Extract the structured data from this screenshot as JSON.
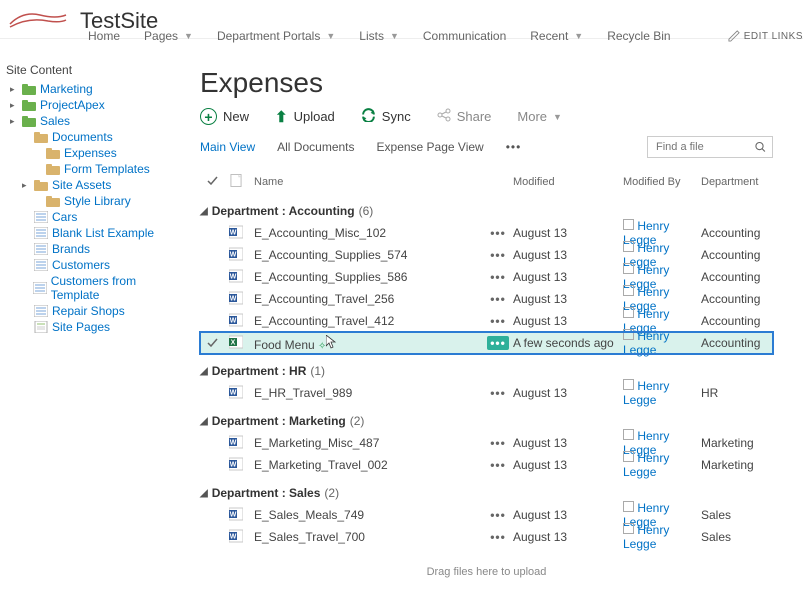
{
  "header": {
    "site_title": "TestSite",
    "nav": [
      "Home",
      "Pages",
      "Department Portals",
      "Lists",
      "Communication",
      "Recent",
      "Recycle Bin"
    ],
    "nav_has_dropdown": [
      false,
      true,
      true,
      true,
      false,
      true,
      false
    ],
    "edit_links_label": "EDIT LINKS"
  },
  "sidebar": {
    "heading": "Site Content",
    "items": [
      {
        "label": "Marketing",
        "level": 1,
        "icon": "folder-green",
        "expandable": true
      },
      {
        "label": "ProjectApex",
        "level": 1,
        "icon": "folder-green",
        "expandable": true
      },
      {
        "label": "Sales",
        "level": 1,
        "icon": "folder-green",
        "expandable": true
      },
      {
        "label": "Documents",
        "level": 2,
        "icon": "folder-tan"
      },
      {
        "label": "Expenses",
        "level": 3,
        "icon": "folder-tan"
      },
      {
        "label": "Form Templates",
        "level": 3,
        "icon": "folder-tan"
      },
      {
        "label": "Site Assets",
        "level": 2,
        "icon": "folder-tan",
        "expandable": true
      },
      {
        "label": "Style Library",
        "level": 3,
        "icon": "folder-tan"
      },
      {
        "label": "Cars",
        "level": 2,
        "icon": "list"
      },
      {
        "label": "Blank List Example",
        "level": 2,
        "icon": "list"
      },
      {
        "label": "Brands",
        "level": 2,
        "icon": "list"
      },
      {
        "label": "Customers",
        "level": 2,
        "icon": "list"
      },
      {
        "label": "Customers from Template",
        "level": 2,
        "icon": "list"
      },
      {
        "label": "Repair Shops",
        "level": 2,
        "icon": "list"
      },
      {
        "label": "Site Pages",
        "level": 2,
        "icon": "page"
      }
    ]
  },
  "main": {
    "title": "Expenses",
    "toolbar": {
      "new": "New",
      "upload": "Upload",
      "sync": "Sync",
      "share": "Share",
      "more": "More"
    },
    "views": {
      "main_view": "Main View",
      "all_docs": "All Documents",
      "expense_page": "Expense Page View"
    },
    "search_placeholder": "Find a file",
    "columns": {
      "name": "Name",
      "modified": "Modified",
      "modified_by": "Modified By",
      "department": "Department"
    },
    "group_label": "Department",
    "groups": [
      {
        "name": "Accounting",
        "count": 6,
        "rows": [
          {
            "icon": "word",
            "name": "E_Accounting_Misc_102",
            "modified": "August 13",
            "by": "Henry Legge",
            "dept": "Accounting"
          },
          {
            "icon": "word",
            "name": "E_Accounting_Supplies_574",
            "modified": "August 13",
            "by": "Henry Legge",
            "dept": "Accounting"
          },
          {
            "icon": "word",
            "name": "E_Accounting_Supplies_586",
            "modified": "August 13",
            "by": "Henry Legge",
            "dept": "Accounting"
          },
          {
            "icon": "word",
            "name": "E_Accounting_Travel_256",
            "modified": "August 13",
            "by": "Henry Legge",
            "dept": "Accounting"
          },
          {
            "icon": "word",
            "name": "E_Accounting_Travel_412",
            "modified": "August 13",
            "by": "Henry Legge",
            "dept": "Accounting"
          },
          {
            "icon": "excel",
            "name": "Food Menu",
            "modified": "A few seconds ago",
            "by": "Henry Legge",
            "dept": "Accounting",
            "highlight": true,
            "new_indicator": true
          }
        ]
      },
      {
        "name": "HR",
        "count": 1,
        "rows": [
          {
            "icon": "word",
            "name": "E_HR_Travel_989",
            "modified": "August 13",
            "by": "Henry Legge",
            "dept": "HR"
          }
        ]
      },
      {
        "name": "Marketing",
        "count": 2,
        "rows": [
          {
            "icon": "word",
            "name": "E_Marketing_Misc_487",
            "modified": "August 13",
            "by": "Henry Legge",
            "dept": "Marketing"
          },
          {
            "icon": "word",
            "name": "E_Marketing_Travel_002",
            "modified": "August 13",
            "by": "Henry Legge",
            "dept": "Marketing"
          }
        ]
      },
      {
        "name": "Sales",
        "count": 2,
        "rows": [
          {
            "icon": "word",
            "name": "E_Sales_Meals_749",
            "modified": "August 13",
            "by": "Henry Legge",
            "dept": "Sales"
          },
          {
            "icon": "word",
            "name": "E_Sales_Travel_700",
            "modified": "August 13",
            "by": "Henry Legge",
            "dept": "Sales"
          }
        ]
      }
    ],
    "dropzone": "Drag files here to upload"
  },
  "colors": {
    "link": "#0072c6",
    "accent": "#0a8043",
    "highlight_bg": "#d9f2ec",
    "highlight_border": "#2b7cd3"
  }
}
